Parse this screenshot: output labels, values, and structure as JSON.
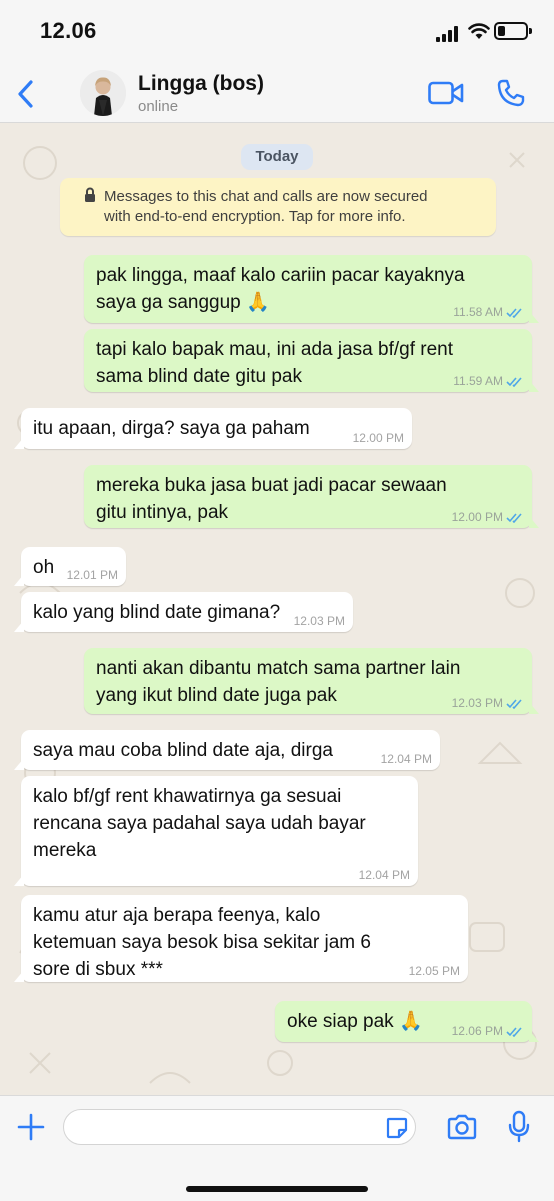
{
  "status_bar": {
    "time": "12.06"
  },
  "header": {
    "contact_name": "Lingga (bos)",
    "contact_status": "online"
  },
  "chat": {
    "date_label": "Today",
    "encryption_notice": [
      "Messages to this chat and calls are now secured",
      "with end-to-end encryption. Tap for more info."
    ],
    "messages": [
      {
        "direction": "out",
        "lines": [
          "pak lingga, maaf kalo cariin pacar kayaknya",
          "saya ga sanggup 🙏"
        ],
        "time": "11.58 AM",
        "read": true
      },
      {
        "direction": "out",
        "lines": [
          "tapi kalo bapak mau, ini ada jasa bf/gf rent",
          "sama blind date gitu pak"
        ],
        "time": "11.59 AM",
        "read": true
      },
      {
        "direction": "in",
        "lines": [
          "itu apaan, dirga? saya ga paham"
        ],
        "time": "12.00 PM"
      },
      {
        "direction": "out",
        "lines": [
          "mereka buka jasa buat jadi pacar sewaan",
          "gitu intinya, pak"
        ],
        "time": "12.00 PM",
        "read": true
      },
      {
        "direction": "in",
        "lines": [
          "oh"
        ],
        "time": "12.01 PM"
      },
      {
        "direction": "in",
        "lines": [
          "kalo yang blind date gimana?"
        ],
        "time": "12.03 PM"
      },
      {
        "direction": "out",
        "lines": [
          "nanti akan dibantu match sama partner lain",
          "yang ikut blind date juga pak"
        ],
        "time": "12.03 PM",
        "read": true
      },
      {
        "direction": "in",
        "lines": [
          "saya mau coba blind date aja, dirga"
        ],
        "time": "12.04 PM"
      },
      {
        "direction": "in",
        "lines": [
          "kalo bf/gf rent khawatirnya ga sesuai",
          "rencana saya padahal saya udah bayar",
          "mereka"
        ],
        "time": "12.04 PM"
      },
      {
        "direction": "in",
        "lines": [
          "kamu atur aja berapa feenya, kalo",
          "ketemuan saya besok bisa sekitar jam 6",
          "sore di sbux ***"
        ],
        "time": "12.05 PM"
      },
      {
        "direction": "out",
        "lines": [
          "oke siap pak 🙏"
        ],
        "time": "12.06 PM",
        "read": true
      }
    ]
  },
  "composer": {
    "input_value": ""
  },
  "colors": {
    "accent": "#2f7cf6",
    "outgoing_bubble": "#dcf8c6",
    "incoming_bubble": "#ffffff",
    "read_ticks": "#4fa6e8"
  },
  "icons": [
    "back-chevron-icon",
    "video-call-icon",
    "phone-icon",
    "lock-icon",
    "plus-icon",
    "sticker-icon",
    "camera-icon",
    "microphone-icon"
  ]
}
